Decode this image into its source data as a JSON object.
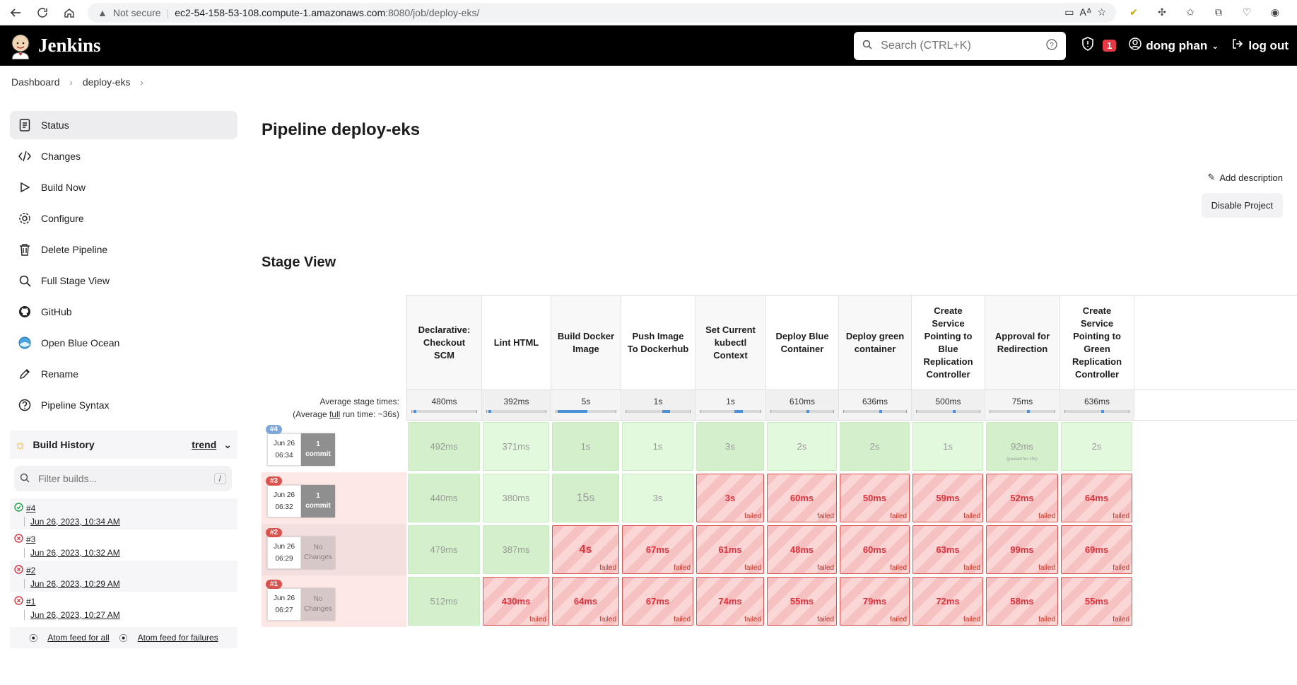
{
  "browser": {
    "security": "Not secure",
    "url_host": "ec2-54-158-53-108.compute-1.amazonaws.com",
    "url_path": ":8080/job/deploy-eks/"
  },
  "header": {
    "brand": "Jenkins",
    "search_placeholder": "Search (CTRL+K)",
    "security_count": "1",
    "user": "dong phan",
    "logout": "log out"
  },
  "breadcrumb": [
    "Dashboard",
    "deploy-eks"
  ],
  "sidebar": {
    "tasks": [
      {
        "label": "Status",
        "icon": "status-icon"
      },
      {
        "label": "Changes",
        "icon": "code-icon"
      },
      {
        "label": "Build Now",
        "icon": "play-icon"
      },
      {
        "label": "Configure",
        "icon": "gear-icon"
      },
      {
        "label": "Delete Pipeline",
        "icon": "trash-icon"
      },
      {
        "label": "Full Stage View",
        "icon": "search-icon"
      },
      {
        "label": "GitHub",
        "icon": "github-icon"
      },
      {
        "label": "Open Blue Ocean",
        "icon": "blue-ocean-icon"
      },
      {
        "label": "Rename",
        "icon": "pencil-icon"
      },
      {
        "label": "Pipeline Syntax",
        "icon": "help-icon"
      }
    ],
    "build_history": {
      "title": "Build History",
      "trend": "trend",
      "filter_placeholder": "Filter builds...",
      "filter_shortcut": "/",
      "builds": [
        {
          "num": "#4",
          "date": "Jun 26, 2023, 10:34 AM",
          "status": "success"
        },
        {
          "num": "#3",
          "date": "Jun 26, 2023, 10:32 AM",
          "status": "failed"
        },
        {
          "num": "#2",
          "date": "Jun 26, 2023, 10:29 AM",
          "status": "failed"
        },
        {
          "num": "#1",
          "date": "Jun 26, 2023, 10:27 AM",
          "status": "failed"
        }
      ],
      "feed_all": "Atom feed for all",
      "feed_failures": "Atom feed for failures"
    }
  },
  "main": {
    "title": "Pipeline deploy-eks",
    "add_description": "Add description",
    "disable_project": "Disable Project",
    "stage_view_title": "Stage View",
    "avg_label_line1": "Average stage times:",
    "avg_label_prefix": "(Average ",
    "avg_label_full": "full",
    "avg_label_suffix": " run time: ~36s)",
    "stages": [
      {
        "name": "Declarative: Checkout SCM",
        "avg": "480ms",
        "bar": 0.02
      },
      {
        "name": "Lint HTML",
        "avg": "392ms",
        "bar": 0.02
      },
      {
        "name": "Build Docker Image",
        "avg": "5s",
        "bar": 0.48
      },
      {
        "name": "Push Image To Dockerhub",
        "avg": "1s",
        "bar": 0.12
      },
      {
        "name": "Set Current kubectl Context",
        "avg": "1s",
        "bar": 0.14
      },
      {
        "name": "Deploy Blue Container",
        "avg": "610ms",
        "bar": 0.04
      },
      {
        "name": "Deploy green container",
        "avg": "636ms",
        "bar": 0.04
      },
      {
        "name": "Create Service Pointing to Blue Replication Controller",
        "avg": "500ms",
        "bar": 0.03
      },
      {
        "name": "Approval for Redirection",
        "avg": "75ms",
        "bar": 0.01
      },
      {
        "name": "Create Service Pointing to Green Replication Controller",
        "avg": "636ms",
        "bar": 0.04
      }
    ],
    "runs": [
      {
        "badge": "#4",
        "badge_color": "blue",
        "date": "Jun 26",
        "time": "06:34",
        "commit_line1": "1",
        "commit_line2": "commit",
        "commit_type": "has",
        "row_class": "ok",
        "cells": [
          {
            "value": "492ms",
            "status": "success",
            "dark": true
          },
          {
            "value": "371ms",
            "status": "success"
          },
          {
            "value": "1s",
            "status": "success",
            "dark": true
          },
          {
            "value": "1s",
            "status": "success"
          },
          {
            "value": "3s",
            "status": "success",
            "dark": true
          },
          {
            "value": "2s",
            "status": "success"
          },
          {
            "value": "2s",
            "status": "success",
            "dark": true
          },
          {
            "value": "1s",
            "status": "success"
          },
          {
            "value": "92ms",
            "status": "success",
            "dark": true,
            "note": "(paused for 19s)"
          },
          {
            "value": "2s",
            "status": "success"
          }
        ]
      },
      {
        "badge": "#3",
        "badge_color": "red",
        "date": "Jun 26",
        "time": "06:32",
        "commit_line1": "1",
        "commit_line2": "commit",
        "commit_type": "has",
        "row_class": "fail1",
        "cells": [
          {
            "value": "440ms",
            "status": "success",
            "dark": true
          },
          {
            "value": "380ms",
            "status": "success"
          },
          {
            "value": "15s",
            "status": "success",
            "dark": true,
            "big": true
          },
          {
            "value": "3s",
            "status": "success"
          },
          {
            "value": "3s",
            "status": "failed"
          },
          {
            "value": "60ms",
            "status": "failed"
          },
          {
            "value": "50ms",
            "status": "failed"
          },
          {
            "value": "59ms",
            "status": "failed"
          },
          {
            "value": "52ms",
            "status": "failed"
          },
          {
            "value": "64ms",
            "status": "failed"
          }
        ]
      },
      {
        "badge": "#2",
        "badge_color": "red",
        "date": "Jun 26",
        "time": "06:29",
        "commit_line1": "No",
        "commit_line2": "Changes",
        "commit_type": "none",
        "row_class": "fail2",
        "cells": [
          {
            "value": "479ms",
            "status": "success",
            "dark": true
          },
          {
            "value": "387ms",
            "status": "success",
            "dark": true
          },
          {
            "value": "4s",
            "status": "failed",
            "big": true
          },
          {
            "value": "67ms",
            "status": "failed"
          },
          {
            "value": "61ms",
            "status": "failed"
          },
          {
            "value": "48ms",
            "status": "failed"
          },
          {
            "value": "60ms",
            "status": "failed"
          },
          {
            "value": "63ms",
            "status": "failed"
          },
          {
            "value": "99ms",
            "status": "failed"
          },
          {
            "value": "69ms",
            "status": "failed"
          }
        ]
      },
      {
        "badge": "#1",
        "badge_color": "red",
        "date": "Jun 26",
        "time": "06:27",
        "commit_line1": "No",
        "commit_line2": "Changes",
        "commit_type": "none",
        "row_class": "fail3",
        "cells": [
          {
            "value": "512ms",
            "status": "success",
            "dark": true
          },
          {
            "value": "430ms",
            "status": "failed"
          },
          {
            "value": "64ms",
            "status": "failed"
          },
          {
            "value": "67ms",
            "status": "failed"
          },
          {
            "value": "74ms",
            "status": "failed"
          },
          {
            "value": "55ms",
            "status": "failed"
          },
          {
            "value": "79ms",
            "status": "failed"
          },
          {
            "value": "72ms",
            "status": "failed"
          },
          {
            "value": "58ms",
            "status": "failed"
          },
          {
            "value": "55ms",
            "status": "failed"
          }
        ]
      }
    ],
    "failed_label": "failed"
  }
}
